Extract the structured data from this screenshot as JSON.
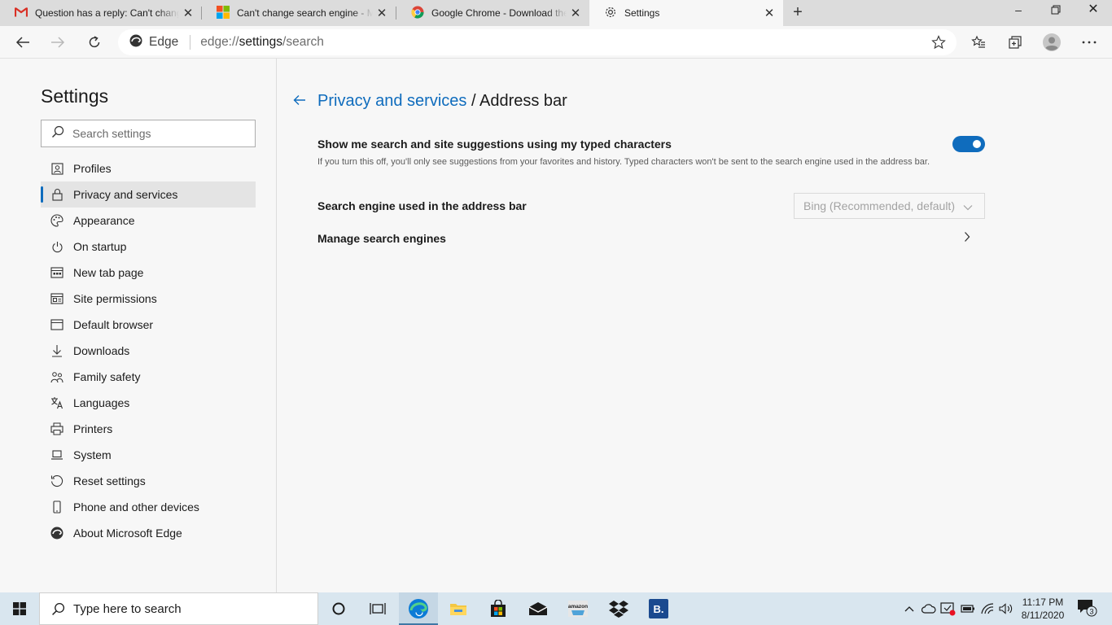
{
  "tabs": [
    {
      "title": "Question has a reply: Can't change",
      "icon": "gmail-icon"
    },
    {
      "title": "Can't change search engine - Mi",
      "icon": "microsoft-icon"
    },
    {
      "title": "Google Chrome - Download the",
      "icon": "chrome-icon"
    },
    {
      "title": "Settings",
      "icon": "gear-icon"
    }
  ],
  "toolbar": {
    "site_name": "Edge",
    "url_scheme": "edge://",
    "url_host": "settings",
    "url_path": "/search"
  },
  "sidebar": {
    "title": "Settings",
    "search_placeholder": "Search settings",
    "items": [
      {
        "label": "Profiles",
        "icon": "profile-card-icon"
      },
      {
        "label": "Privacy and services",
        "icon": "lock-icon"
      },
      {
        "label": "Appearance",
        "icon": "palette-icon"
      },
      {
        "label": "On startup",
        "icon": "power-icon"
      },
      {
        "label": "New tab page",
        "icon": "new-tab-icon"
      },
      {
        "label": "Site permissions",
        "icon": "site-permissions-icon"
      },
      {
        "label": "Default browser",
        "icon": "browser-icon"
      },
      {
        "label": "Downloads",
        "icon": "download-icon"
      },
      {
        "label": "Family safety",
        "icon": "family-icon"
      },
      {
        "label": "Languages",
        "icon": "languages-icon"
      },
      {
        "label": "Printers",
        "icon": "printer-icon"
      },
      {
        "label": "System",
        "icon": "laptop-icon"
      },
      {
        "label": "Reset settings",
        "icon": "reset-icon"
      },
      {
        "label": "Phone and other devices",
        "icon": "phone-icon"
      },
      {
        "label": "About Microsoft Edge",
        "icon": "edge-logo-icon"
      }
    ],
    "selected_index": 1
  },
  "main": {
    "breadcrumb_parent": "Privacy and services",
    "breadcrumb_sep": " / ",
    "page_title": "Address bar",
    "suggestions_label": "Show me search and site suggestions using my typed characters",
    "suggestions_desc": "If you turn this off, you'll only see suggestions from your favorites and history. Typed characters won't be sent to the search engine used in the address bar.",
    "suggestions_enabled": true,
    "engine_label": "Search engine used in the address bar",
    "engine_value": "Bing (Recommended, default)",
    "manage_label": "Manage search engines"
  },
  "taskbar": {
    "search_placeholder": "Type here to search",
    "time": "11:17 PM",
    "date": "8/11/2020",
    "notification_count": "3",
    "amazon_label": "amazon",
    "booking_label": "B."
  },
  "colors": {
    "accent": "#0f6cbd",
    "taskbar": "#d9e6ef"
  }
}
